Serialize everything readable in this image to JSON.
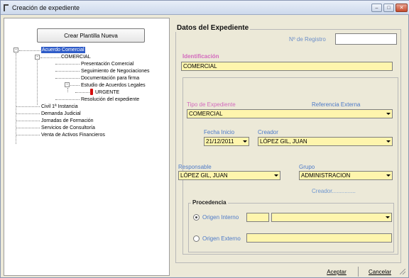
{
  "window": {
    "title": "Creación de expediente",
    "controls": {
      "minimize": "–",
      "maximize": "□",
      "close": "✕"
    }
  },
  "left_panel": {
    "crear_button": "Crear Plantilla Nueva",
    "tree": {
      "acuerdo_comercial": "Acuerdo Comercial",
      "comercial": "COMERCIAL",
      "presentacion": "Presentación Comercial",
      "seguimiento": "Seguimiento de Negociaciones",
      "documentacion": "Documentación para firma",
      "estudio": "Estudio de Acuerdos Legales",
      "urgente": "URGENTE",
      "resolucion": "Resolución del expediente",
      "civil": "Civil 1ª Instancia",
      "demanda": "Demanda Judicial",
      "jornadas": "Jornadas de Formación",
      "servicios": "Servicios de Consultoría",
      "venta": "Venta de Activos Financieros"
    }
  },
  "form": {
    "section_title": "Datos del Expediente",
    "registro_label": "Nº de Registro",
    "registro_value": "",
    "identificacion_label": "Identificación",
    "identificacion_value": "COMERCIAL",
    "referencia_label": "Referencia Externa",
    "referencia_value": "",
    "tipo_label": "Tipo de Expediente",
    "tipo_value": "COMERCIAL",
    "fecha_label": "Fecha Inicio",
    "fecha_value": "21/12/2011",
    "creador_label": "Creador",
    "creador_value": "LÓPEZ GIL, JUAN",
    "responsable_label": "Responsable",
    "responsable_value": "LÓPEZ GIL, JUAN",
    "grupo_label": "Grupo",
    "grupo_value": "ADMINISTRACION",
    "creador_note": "Creador...............",
    "procedencia_label": "Procedencia",
    "origen_interno_label": "Origen Interno",
    "origen_interno_code": "",
    "origen_interno_value": "",
    "origen_externo_label": "Origen Externo",
    "origen_externo_value": ""
  },
  "buttons": {
    "aceptar": "Aceptar",
    "cancelar": "Cancelar"
  },
  "colors": {
    "field_yellow": "#fef5ad",
    "selection_blue": "#2f5cc8",
    "label_blue": "#4d7ac8",
    "label_pink": "#d36abd"
  }
}
